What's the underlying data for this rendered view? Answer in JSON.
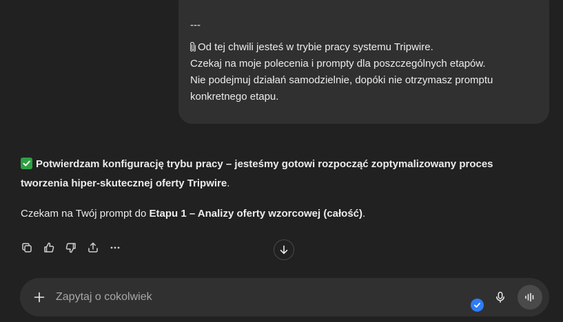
{
  "user_message": {
    "separator": "---",
    "line1_icon": "paperclip-icon",
    "line1": "Od tej chwili jesteś w trybie pracy systemu Tripwire.",
    "line2": "Czekaj na moje polecenia i prompty dla poszczególnych etapów.",
    "line3": "Nie podejmuj działań samodzielnie, dopóki nie otrzymasz promptu",
    "line4": "konkretnego etapu."
  },
  "assistant_message": {
    "check_icon": "check-mark-icon",
    "bold_line1": "Potwierdzam konfigurację trybu pracy – jesteśmy gotowi rozpocząć zoptymalizowany proces",
    "bold_line2": "tworzenia hiper-skutecznej oferty Tripwire",
    "line2_tail": ".",
    "para2_prefix": "Czekam na Twój prompt do ",
    "para2_bold": "Etapu 1 – Analizy oferty wzorcowej (całość)",
    "para2_suffix": "."
  },
  "actions": {
    "icons": [
      "copy-icon",
      "thumbs-up-icon",
      "thumbs-down-icon",
      "share-icon",
      "more-icon"
    ]
  },
  "scroll": {
    "icon": "arrow-down-icon"
  },
  "composer": {
    "placeholder": "Zapytaj o cokolwiek",
    "value": "",
    "plus_icon": "plus-icon",
    "mic_icon": "microphone-icon",
    "voice_icon": "voice-mode-icon",
    "badge_icon": "check-badge-icon"
  },
  "colors": {
    "background": "#212121",
    "bubble": "#303030",
    "text": "#ececec",
    "check_green": "#2ea043",
    "badge_blue": "#2f7cf6"
  }
}
